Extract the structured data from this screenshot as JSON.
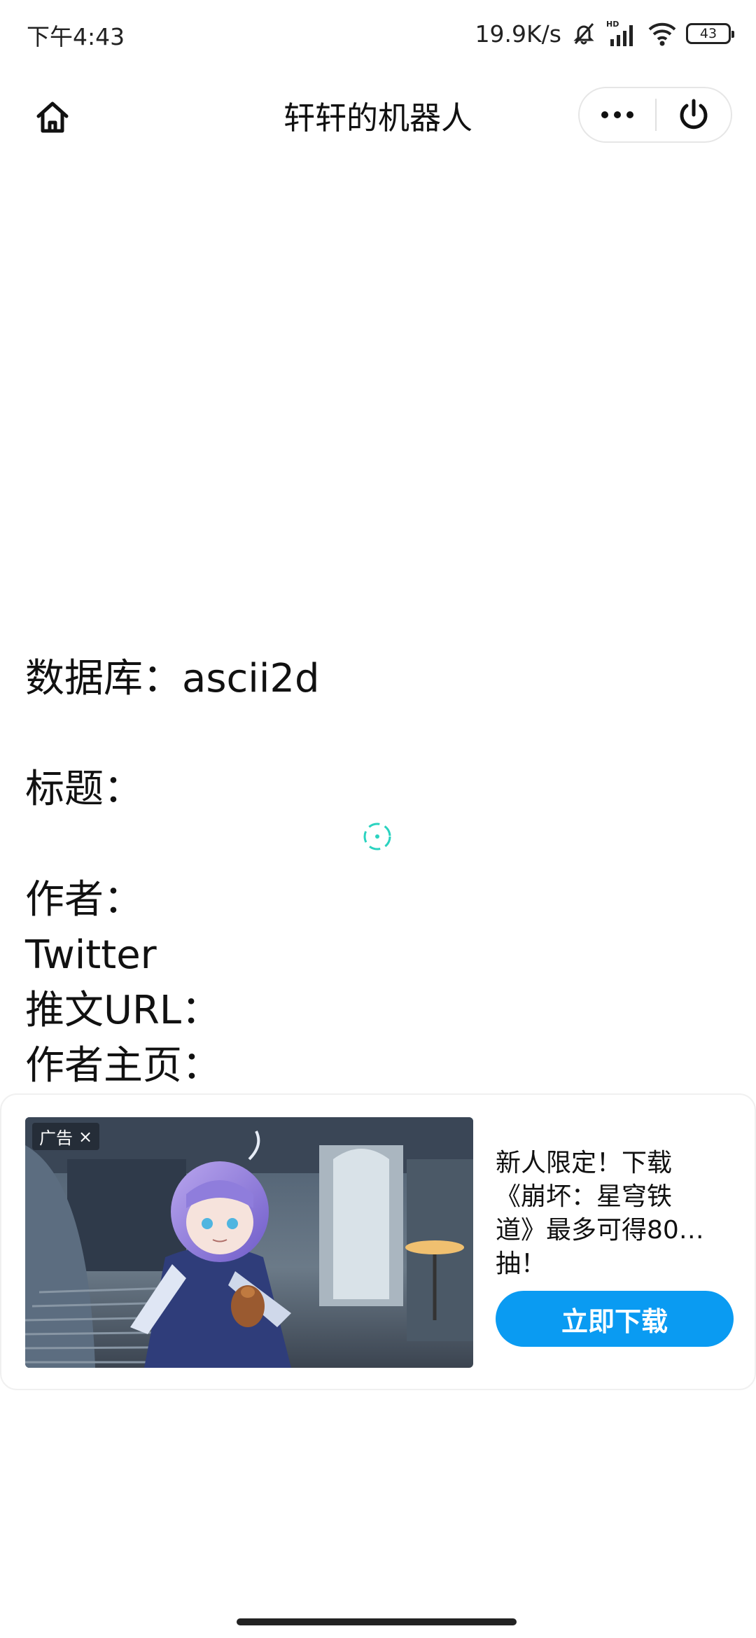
{
  "status_bar": {
    "time": "下午4:43",
    "net_speed": "19.9K/s",
    "battery": "43",
    "icons": [
      "mute-icon",
      "signal-hd-icon",
      "wifi-icon",
      "battery-icon"
    ]
  },
  "nav": {
    "title": "轩轩的机器人",
    "icons": [
      "home-icon",
      "more-icon",
      "power-icon"
    ]
  },
  "content": {
    "database": "数据库：ascii2d",
    "title_label": "标题：",
    "author_label": "作者：",
    "platform": "Twitter",
    "tweet_url_label": "推文URL：",
    "author_page_label": "作者主页："
  },
  "ad": {
    "badge": "广告",
    "badge_close": "×",
    "text_lines": [
      "新人限定！下载",
      "《崩坏：星穹铁",
      "道》最多可得80…",
      "抽！"
    ],
    "button": "立即下载",
    "button_color": "#0a9bf2"
  },
  "colors": {
    "loading_accent": "#2bd3c0"
  }
}
